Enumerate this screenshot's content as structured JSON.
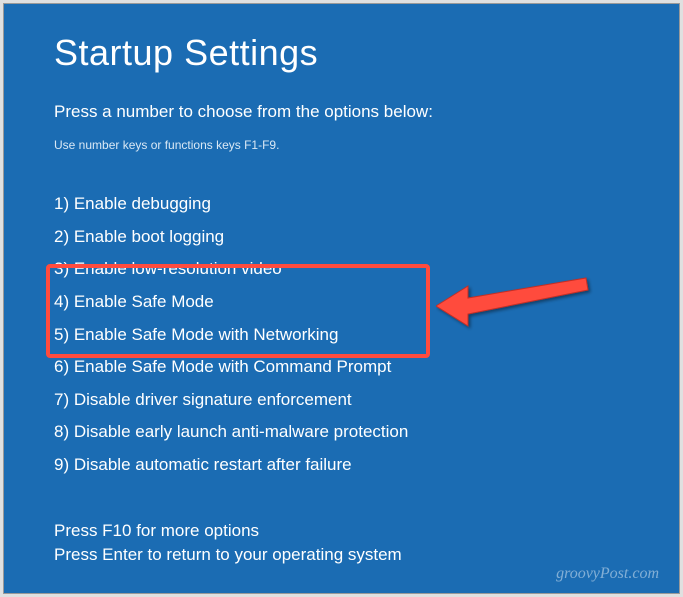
{
  "title": "Startup Settings",
  "subtitle": "Press a number to choose from the options below:",
  "instruction": "Use number keys or functions keys F1-F9.",
  "options": [
    "1) Enable debugging",
    "2) Enable boot logging",
    "3) Enable low-resolution video",
    "4) Enable Safe Mode",
    "5) Enable Safe Mode with Networking",
    "6) Enable Safe Mode with Command Prompt",
    "7) Disable driver signature enforcement",
    "8) Disable early launch anti-malware protection",
    "9) Disable automatic restart after failure"
  ],
  "footer": {
    "more": "Press F10 for more options",
    "return": "Press Enter to return to your operating system"
  },
  "watermark": "groovyPost.com"
}
